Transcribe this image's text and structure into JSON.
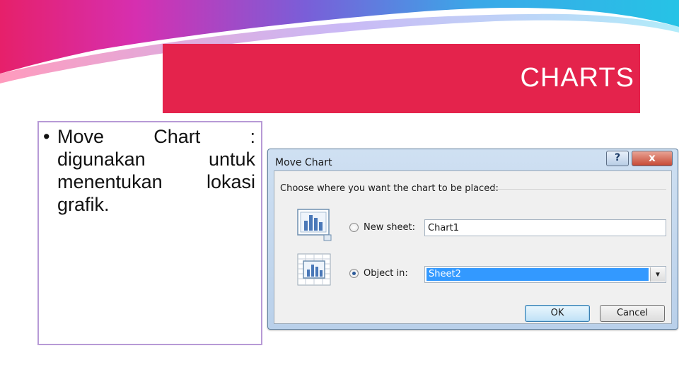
{
  "slide": {
    "title": "CHARTS",
    "bullet_text": "Move Chart : digunakan untuk menentukan lokasi grafik.",
    "bullet_symbol": "•"
  },
  "dialog": {
    "title": "Move Chart",
    "help_button": "?",
    "close_button": "x",
    "group_label": "Choose where you want the chart to be placed:",
    "new_sheet_label": "New sheet:",
    "new_sheet_value": "Chart1",
    "object_in_label": "Object in:",
    "object_in_value": "Sheet2",
    "selected_option": "object_in",
    "ok_label": "OK",
    "cancel_label": "Cancel",
    "dropdown_arrow": "▼"
  },
  "colors": {
    "title_bar": "#e4234c",
    "content_border": "#b79ad6",
    "selection": "#3399ff"
  }
}
